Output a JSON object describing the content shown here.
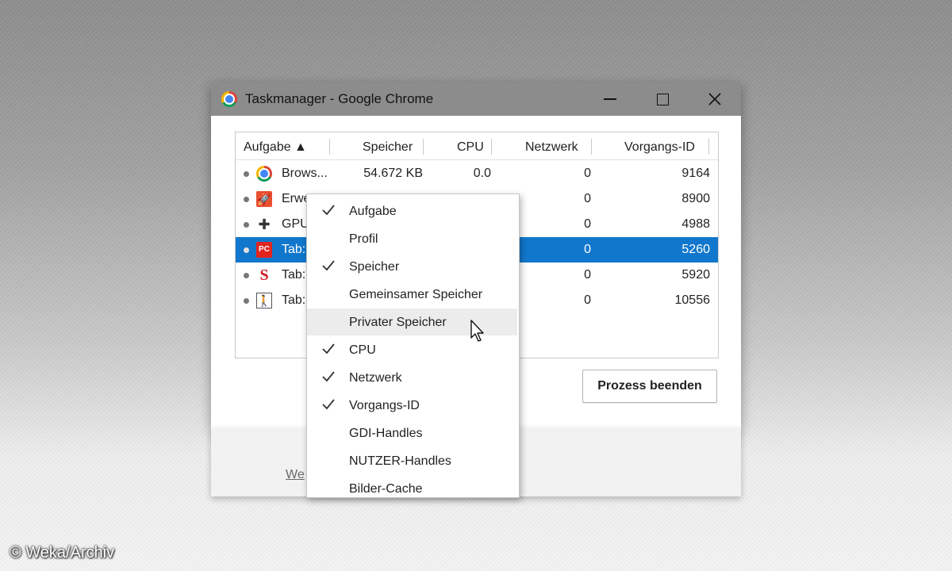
{
  "window": {
    "title": "Taskmanager - Google Chrome"
  },
  "table": {
    "columns": [
      "Aufgabe ▲",
      "Speicher",
      "CPU",
      "Netzwerk",
      "Vorgangs-ID"
    ],
    "rows": [
      {
        "icon": "chrome-icon",
        "task": "Brows...",
        "memory": "54.672 KB",
        "cpu": "0.0",
        "network": "0",
        "pid": "9164"
      },
      {
        "icon": "rocket-extension-icon",
        "task": "Erwe",
        "memory": "",
        "cpu": "",
        "network": "0",
        "pid": "8900"
      },
      {
        "icon": "puzzle-piece-icon",
        "task": "GPU",
        "memory": "",
        "cpu": "",
        "network": "0",
        "pid": "4988"
      },
      {
        "icon": "pc-magazine-icon",
        "task": "Tab:",
        "memory": "",
        "cpu": "",
        "network": "0",
        "pid": "5260",
        "selected": true
      },
      {
        "icon": "stanford-s-icon",
        "task": "Tab:",
        "memory": "",
        "cpu": "",
        "network": "0",
        "pid": "5920"
      },
      {
        "icon": "hiker-icon",
        "task": "Tab:",
        "memory": "",
        "cpu": "",
        "network": "0",
        "pid": "10556"
      }
    ]
  },
  "buttons": {
    "end_process": "Prozess beenden"
  },
  "lower_panel": {
    "link_fragment": "We"
  },
  "context_menu": {
    "items": [
      {
        "label": "Aufgabe",
        "checked": true
      },
      {
        "label": "Profil",
        "checked": false
      },
      {
        "label": "Speicher",
        "checked": true
      },
      {
        "label": "Gemeinsamer Speicher",
        "checked": false
      },
      {
        "label": "Privater Speicher",
        "checked": false,
        "hovered": true
      },
      {
        "label": "CPU",
        "checked": true
      },
      {
        "label": "Netzwerk",
        "checked": true
      },
      {
        "label": "Vorgangs-ID",
        "checked": true
      },
      {
        "label": "GDI-Handles",
        "checked": false
      },
      {
        "label": "NUTZER-Handles",
        "checked": false
      },
      {
        "label": "Bilder-Cache",
        "checked": false
      }
    ]
  },
  "watermark": "© Weka/Archiv",
  "colors": {
    "selection": "#1177cc",
    "titlebar": "#8c8c8c"
  }
}
